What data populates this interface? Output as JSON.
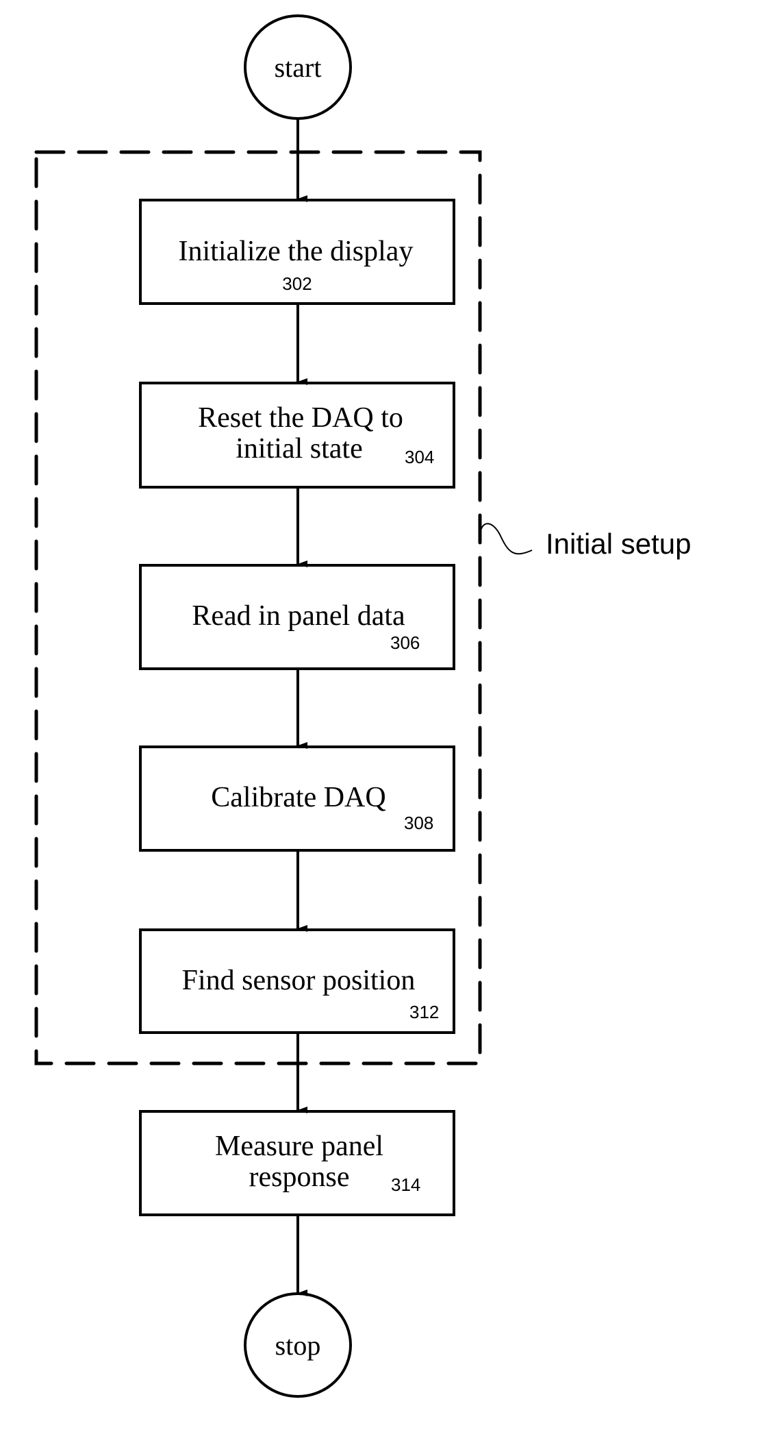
{
  "diagram": {
    "type": "flowchart",
    "terminals": {
      "start": "start",
      "stop": "stop"
    },
    "group": {
      "label": "Initial setup",
      "style": "dashed",
      "contains": [
        "302",
        "304",
        "306",
        "308",
        "312"
      ]
    },
    "steps": [
      {
        "id": "302",
        "lines": [
          "Initialize the display"
        ],
        "ref": "302"
      },
      {
        "id": "304",
        "lines": [
          "Reset the DAQ to",
          "initial state"
        ],
        "ref": "304"
      },
      {
        "id": "306",
        "lines": [
          "Read in panel data"
        ],
        "ref": "306"
      },
      {
        "id": "308",
        "lines": [
          "Calibrate DAQ"
        ],
        "ref": "308"
      },
      {
        "id": "312",
        "lines": [
          "Find sensor position"
        ],
        "ref": "312"
      },
      {
        "id": "314",
        "lines": [
          "Measure panel",
          "response"
        ],
        "ref": "314"
      }
    ],
    "edges": [
      [
        "start",
        "302"
      ],
      [
        "302",
        "304"
      ],
      [
        "304",
        "306"
      ],
      [
        "306",
        "308"
      ],
      [
        "308",
        "312"
      ],
      [
        "312",
        "314"
      ],
      [
        "314",
        "stop"
      ]
    ],
    "colors": {
      "stroke": "#000000",
      "background": "#ffffff"
    }
  }
}
